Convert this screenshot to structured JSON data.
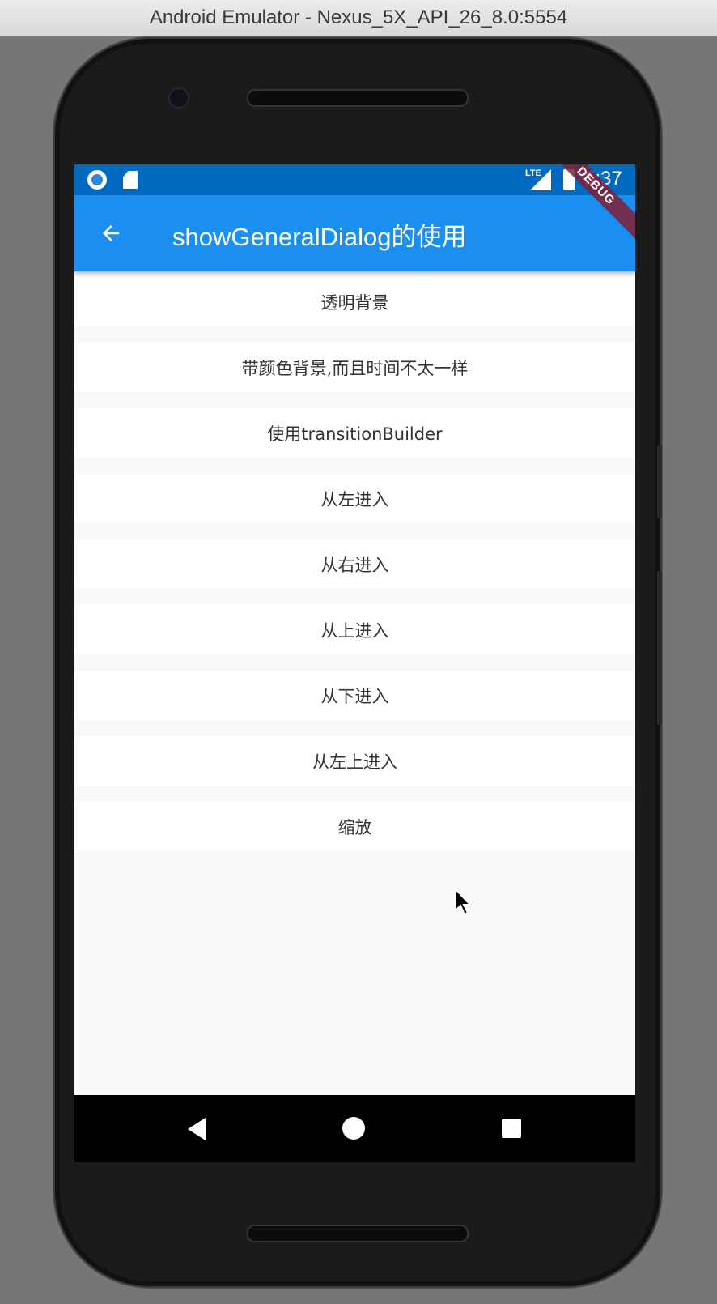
{
  "window": {
    "title": "Android Emulator - Nexus_5X_API_26_8.0:5554"
  },
  "status_bar": {
    "time": "5:37",
    "network": "LTE",
    "icons": [
      "record-icon",
      "sd-card-icon",
      "lte-signal-icon",
      "battery-icon"
    ],
    "background": "#0069c0"
  },
  "app_bar": {
    "title": "showGeneralDialog的使用",
    "back_icon": "back-arrow-icon",
    "background": "#1a8ff0",
    "debug_banner": "DEBUG"
  },
  "list": {
    "items": [
      {
        "label": "透明背景"
      },
      {
        "label": "带颜色背景,而且时间不太一样"
      },
      {
        "label": "使用transitionBuilder"
      },
      {
        "label": "从左进入"
      },
      {
        "label": "从右进入"
      },
      {
        "label": "从上进入"
      },
      {
        "label": "从下进入"
      },
      {
        "label": "从左上进入"
      },
      {
        "label": "缩放"
      }
    ]
  },
  "nav_bar": {
    "icons": [
      "nav-back-icon",
      "nav-home-icon",
      "nav-recents-icon"
    ]
  }
}
